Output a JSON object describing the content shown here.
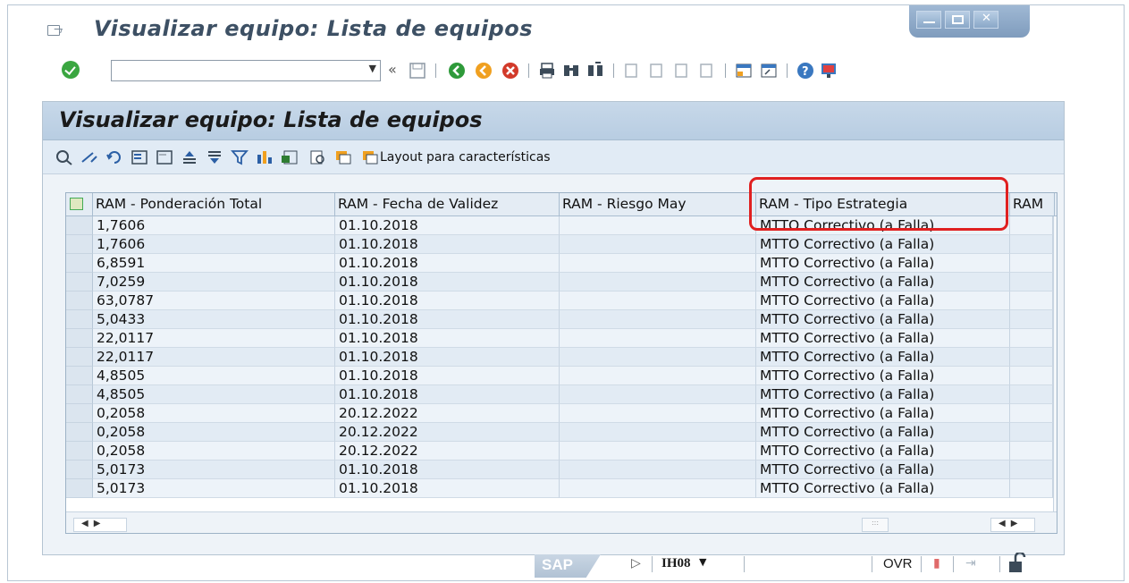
{
  "window": {
    "title": "Visualizar equipo: Lista de equipos"
  },
  "toolbar": {
    "command_value": "",
    "nav_back_label": "«",
    "icons": [
      "save-icon",
      "back-icon",
      "exit-icon",
      "cancel-icon",
      "print-icon",
      "find-icon",
      "find-next-icon",
      "first-page-icon",
      "prev-page-icon",
      "next-page-icon",
      "last-page-icon",
      "create-session-icon",
      "shortcut-icon",
      "help-icon",
      "customize-icon"
    ]
  },
  "panel": {
    "title": "Visualizar equipo: Lista de equipos",
    "layout_label": "Layout para características"
  },
  "grid": {
    "columns": [
      "RAM - Ponderación Total",
      "RAM - Fecha de Validez",
      "RAM - Riesgo May",
      "RAM - Tipo Estrategia",
      "RAM"
    ],
    "rows": [
      [
        "1,7606",
        "01.10.2018",
        "",
        "MTTO Correctivo (a Falla)"
      ],
      [
        "1,7606",
        "01.10.2018",
        "",
        "MTTO Correctivo (a Falla)"
      ],
      [
        "6,8591",
        "01.10.2018",
        "",
        "MTTO Correctivo (a Falla)"
      ],
      [
        "7,0259",
        "01.10.2018",
        "",
        "MTTO Correctivo (a Falla)"
      ],
      [
        "63,0787",
        "01.10.2018",
        "",
        "MTTO Correctivo (a Falla)"
      ],
      [
        "5,0433",
        "01.10.2018",
        "",
        "MTTO Correctivo (a Falla)"
      ],
      [
        "22,0117",
        "01.10.2018",
        "",
        "MTTO Correctivo (a Falla)"
      ],
      [
        "22,0117",
        "01.10.2018",
        "",
        "MTTO Correctivo (a Falla)"
      ],
      [
        "4,8505",
        "01.10.2018",
        "",
        "MTTO Correctivo (a Falla)"
      ],
      [
        "4,8505",
        "01.10.2018",
        "",
        "MTTO Correctivo (a Falla)"
      ],
      [
        "0,2058",
        "20.12.2022",
        "",
        "MTTO Correctivo (a Falla)"
      ],
      [
        "0,2058",
        "20.12.2022",
        "",
        "MTTO Correctivo (a Falla)"
      ],
      [
        "0,2058",
        "20.12.2022",
        "",
        "MTTO Correctivo (a Falla)"
      ],
      [
        "5,0173",
        "01.10.2018",
        "",
        "MTTO Correctivo (a Falla)"
      ],
      [
        "5,0173",
        "01.10.2018",
        "",
        "MTTO Correctivo (a Falla)"
      ]
    ]
  },
  "statusbar": {
    "logo": "SAP",
    "transaction": "IH08",
    "mode": "OVR"
  },
  "colors": {
    "highlight": "#e02020",
    "title": "#3d5064",
    "panel_header": "#c7d8e9"
  }
}
